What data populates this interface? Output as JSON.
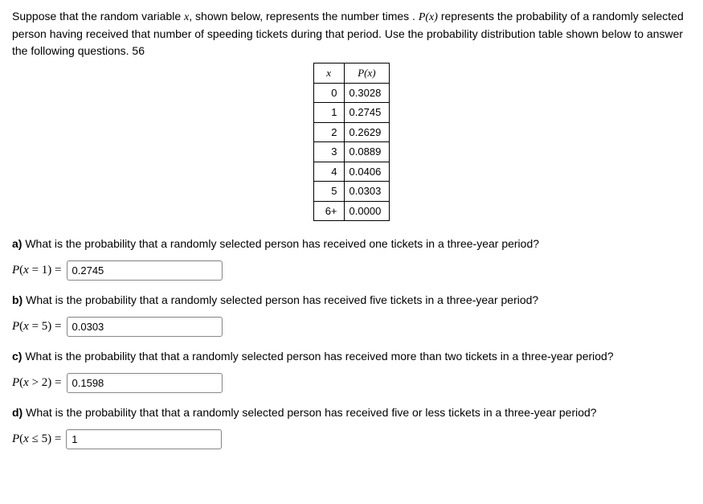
{
  "intro": {
    "text_before_x": "Suppose that the random variable ",
    "var_x": "x",
    "text_mid1": ", shown below, represents the number times . ",
    "px_expr": "P(x)",
    "text_mid2": " represents the probability of a randomly selected person having received that number of speeding tickets during that period. Use the probability distribution table shown below to answer the following questions. 56"
  },
  "table": {
    "header_x": "x",
    "header_px": "P(x)",
    "rows": [
      {
        "x": "0",
        "p": "0.3028"
      },
      {
        "x": "1",
        "p": "0.2745"
      },
      {
        "x": "2",
        "p": "0.2629"
      },
      {
        "x": "3",
        "p": "0.0889"
      },
      {
        "x": "4",
        "p": "0.0406"
      },
      {
        "x": "5",
        "p": "0.0303"
      },
      {
        "x": "6+",
        "p": "0.0000"
      }
    ]
  },
  "qa": {
    "a": {
      "label": "a)",
      "text": " What is the probability that a randomly selected person has received one tickets in a three-year period?",
      "expr": "P(x = 1) = ",
      "value": "0.2745"
    },
    "b": {
      "label": "b)",
      "text": " What is the probability that a randomly selected person has received five tickets in a three-year period?",
      "expr": "P(x = 5) = ",
      "value": "0.0303"
    },
    "c": {
      "label": "c)",
      "text": " What is the probability that that a randomly selected person has received more than two tickets in a three-year period?",
      "expr": "P(x > 2) = ",
      "value": "0.1598"
    },
    "d": {
      "label": "d)",
      "text": " What is the probability that that a randomly selected person has received five or less tickets in a three-year period?",
      "expr": "P(x ≤ 5) = ",
      "value": "1"
    }
  }
}
